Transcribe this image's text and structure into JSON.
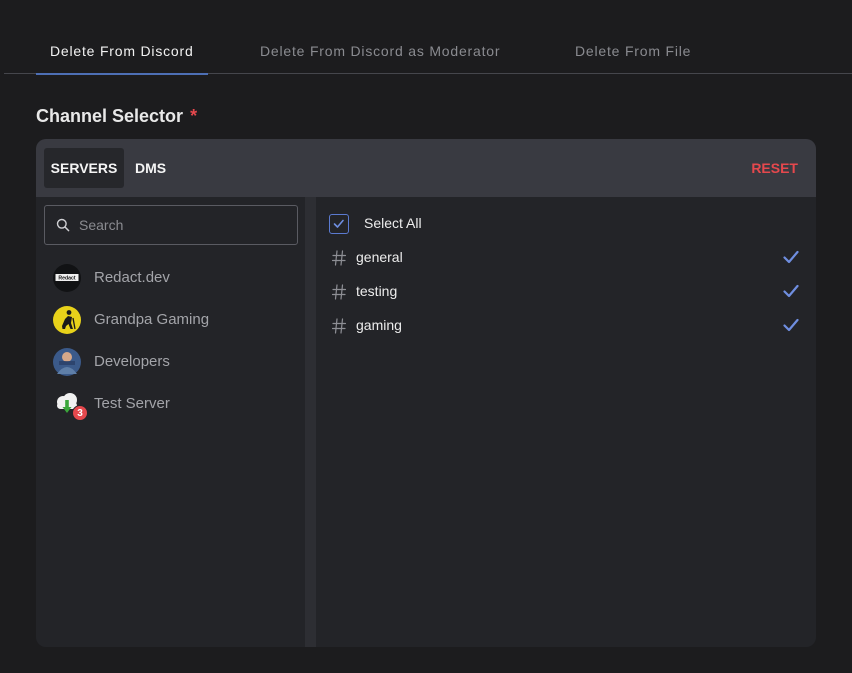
{
  "tabs": [
    {
      "label": "Delete From Discord",
      "active": true
    },
    {
      "label": "Delete From Discord as Moderator",
      "active": false
    },
    {
      "label": "Delete From File",
      "active": false
    }
  ],
  "channel_selector": {
    "title": "Channel Selector",
    "required_mark": "*",
    "segments": {
      "servers": "SERVERS",
      "dms": "DMS",
      "active": "SERVERS"
    },
    "reset_label": "RESET",
    "search": {
      "placeholder": "Search",
      "value": "",
      "icon": "search-icon"
    },
    "servers": [
      {
        "name": "Redact.dev",
        "logo_text": "Redact"
      },
      {
        "name": "Grandpa Gaming"
      },
      {
        "name": "Developers"
      },
      {
        "name": "Test Server",
        "badge": "3"
      }
    ],
    "select_all": {
      "label": "Select All",
      "checked": true
    },
    "channels": [
      {
        "name": "general",
        "selected": true
      },
      {
        "name": "testing",
        "selected": true
      },
      {
        "name": "gaming",
        "selected": true
      }
    ]
  },
  "colors": {
    "accent": "#5b7ad0",
    "danger": "#e5484d",
    "background": "#1c1c1e",
    "panel": "#232428",
    "panel_header": "#393a41"
  }
}
